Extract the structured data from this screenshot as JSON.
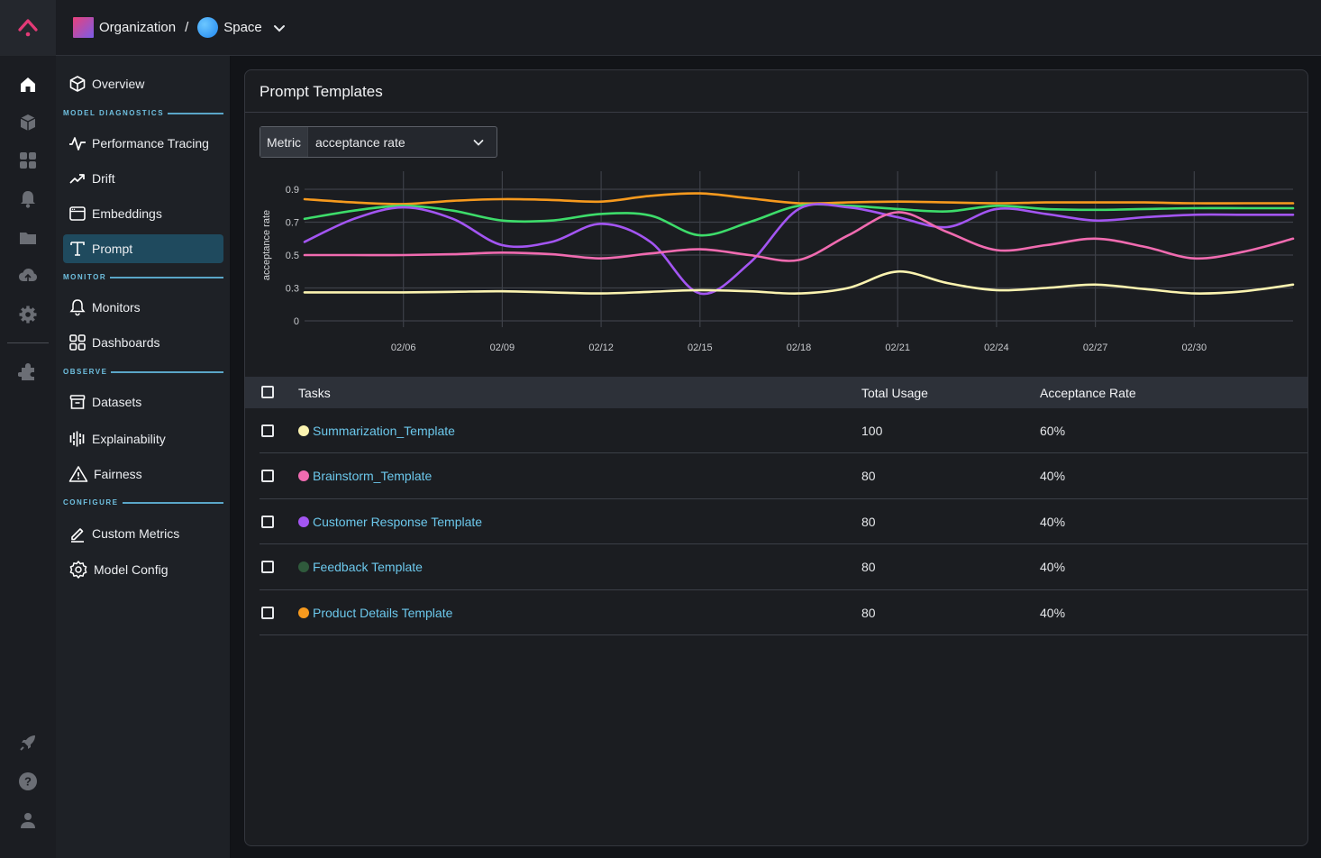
{
  "topbar": {
    "organization": "Organization",
    "separator": "/",
    "space": "Space",
    "org_gradient": [
      "#e9417a",
      "#7a5ce8"
    ],
    "space_color": "#2f9bf5",
    "logo_color": "#e33a76"
  },
  "rail": {
    "items": [
      {
        "icon": "home-icon",
        "active": true
      },
      {
        "icon": "cube-icon"
      },
      {
        "icon": "grid-icon"
      },
      {
        "icon": "bell-icon"
      },
      {
        "icon": "folder-icon"
      },
      {
        "icon": "cloud-upload-icon"
      },
      {
        "icon": "gear-icon"
      },
      {
        "icon": "puzzle-icon"
      }
    ],
    "bottom": [
      {
        "icon": "rocket-icon"
      },
      {
        "icon": "help-icon"
      },
      {
        "icon": "user-icon"
      }
    ]
  },
  "sidenav": {
    "overview": "Overview",
    "sections": {
      "model_diagnostics": "MODEL DIAGNOSTICS",
      "monitor": "MONITOR",
      "observe": "OBSERVE",
      "configure": "CONFIGURE"
    },
    "items": {
      "performance_tracing": "Performance Tracing",
      "drift": "Drift",
      "embeddings": "Embeddings",
      "prompt": "Prompt",
      "monitors": "Monitors",
      "dashboards": "Dashboards",
      "datasets": "Datasets",
      "explainability": "Explainability",
      "fairness": "Fairness",
      "custom_metrics": "Custom Metrics",
      "model_config": "Model Config"
    },
    "active": "Prompt",
    "section_color": "#6fc0e0",
    "active_bg": "#1f4a5e"
  },
  "card": {
    "title": "Prompt Templates",
    "metric_label": "Metric",
    "metric_value": "acceptance rate"
  },
  "chart_data": {
    "type": "line",
    "ylabel": "acceptance rate",
    "xlabel": "",
    "y_ticks": [
      "0",
      "0.3",
      "0.5",
      "0.7",
      "0.9"
    ],
    "y_tick_values": [
      0,
      0.3,
      0.5,
      0.7,
      0.9
    ],
    "x_ticks": [
      "02/06",
      "02/09",
      "02/12",
      "02/15",
      "02/18",
      "02/21",
      "02/24",
      "02/27",
      "02/30"
    ],
    "x_day_range": [
      3,
      33
    ],
    "grid": true,
    "legend": "table-below",
    "x_days": [
      3,
      4.5,
      6,
      7.5,
      9,
      10.5,
      12,
      13.5,
      15,
      16.5,
      18,
      19.5,
      21,
      22.5,
      24,
      25.5,
      27,
      28.5,
      30,
      31.5,
      33
    ],
    "series": [
      {
        "name": "Product Details Template",
        "color": "#f79a1e",
        "values": [
          0.84,
          0.82,
          0.81,
          0.83,
          0.84,
          0.835,
          0.825,
          0.86,
          0.875,
          0.845,
          0.815,
          0.82,
          0.825,
          0.82,
          0.815,
          0.82,
          0.82,
          0.82,
          0.815,
          0.815,
          0.815
        ]
      },
      {
        "name": "Feedback Template",
        "color": "#3ddc6a",
        "values": [
          0.72,
          0.77,
          0.8,
          0.77,
          0.71,
          0.71,
          0.75,
          0.74,
          0.62,
          0.7,
          0.8,
          0.8,
          0.78,
          0.765,
          0.8,
          0.78,
          0.775,
          0.78,
          0.785,
          0.785,
          0.785
        ]
      },
      {
        "name": "Customer Response Template",
        "color": "#a355f2",
        "values": [
          0.58,
          0.72,
          0.79,
          0.72,
          0.56,
          0.58,
          0.69,
          0.58,
          0.25,
          0.45,
          0.78,
          0.79,
          0.73,
          0.67,
          0.78,
          0.75,
          0.71,
          0.73,
          0.745,
          0.745,
          0.745
        ]
      },
      {
        "name": "Brainstorm_Template",
        "color": "#f06bb0",
        "values": [
          0.5,
          0.5,
          0.5,
          0.505,
          0.515,
          0.505,
          0.48,
          0.51,
          0.535,
          0.5,
          0.47,
          0.62,
          0.76,
          0.64,
          0.53,
          0.56,
          0.6,
          0.55,
          0.48,
          0.52,
          0.6
        ]
      },
      {
        "name": "Summarization_Template",
        "color": "#fbf3b0",
        "values": [
          0.26,
          0.26,
          0.26,
          0.265,
          0.27,
          0.26,
          0.25,
          0.265,
          0.28,
          0.27,
          0.25,
          0.3,
          0.4,
          0.33,
          0.28,
          0.3,
          0.32,
          0.29,
          0.25,
          0.27,
          0.32
        ]
      }
    ]
  },
  "table": {
    "headers": {
      "tasks": "Tasks",
      "usage": "Total Usage",
      "rate": "Acceptance Rate"
    },
    "rows": [
      {
        "task": "Summarization_Template",
        "color": "#fbf3b0",
        "usage": "100",
        "rate": "60%"
      },
      {
        "task": "Brainstorm_Template",
        "color": "#f06bb0",
        "usage": "80",
        "rate": "40%"
      },
      {
        "task": "Customer Response Template",
        "color": "#a355f2",
        "usage": "80",
        "rate": "40%"
      },
      {
        "task": "Feedback Template",
        "color": "#2f5a3c",
        "usage": "80",
        "rate": "40%"
      },
      {
        "task": "Product Details Template",
        "color": "#f79a1e",
        "usage": "80",
        "rate": "40%"
      }
    ]
  }
}
